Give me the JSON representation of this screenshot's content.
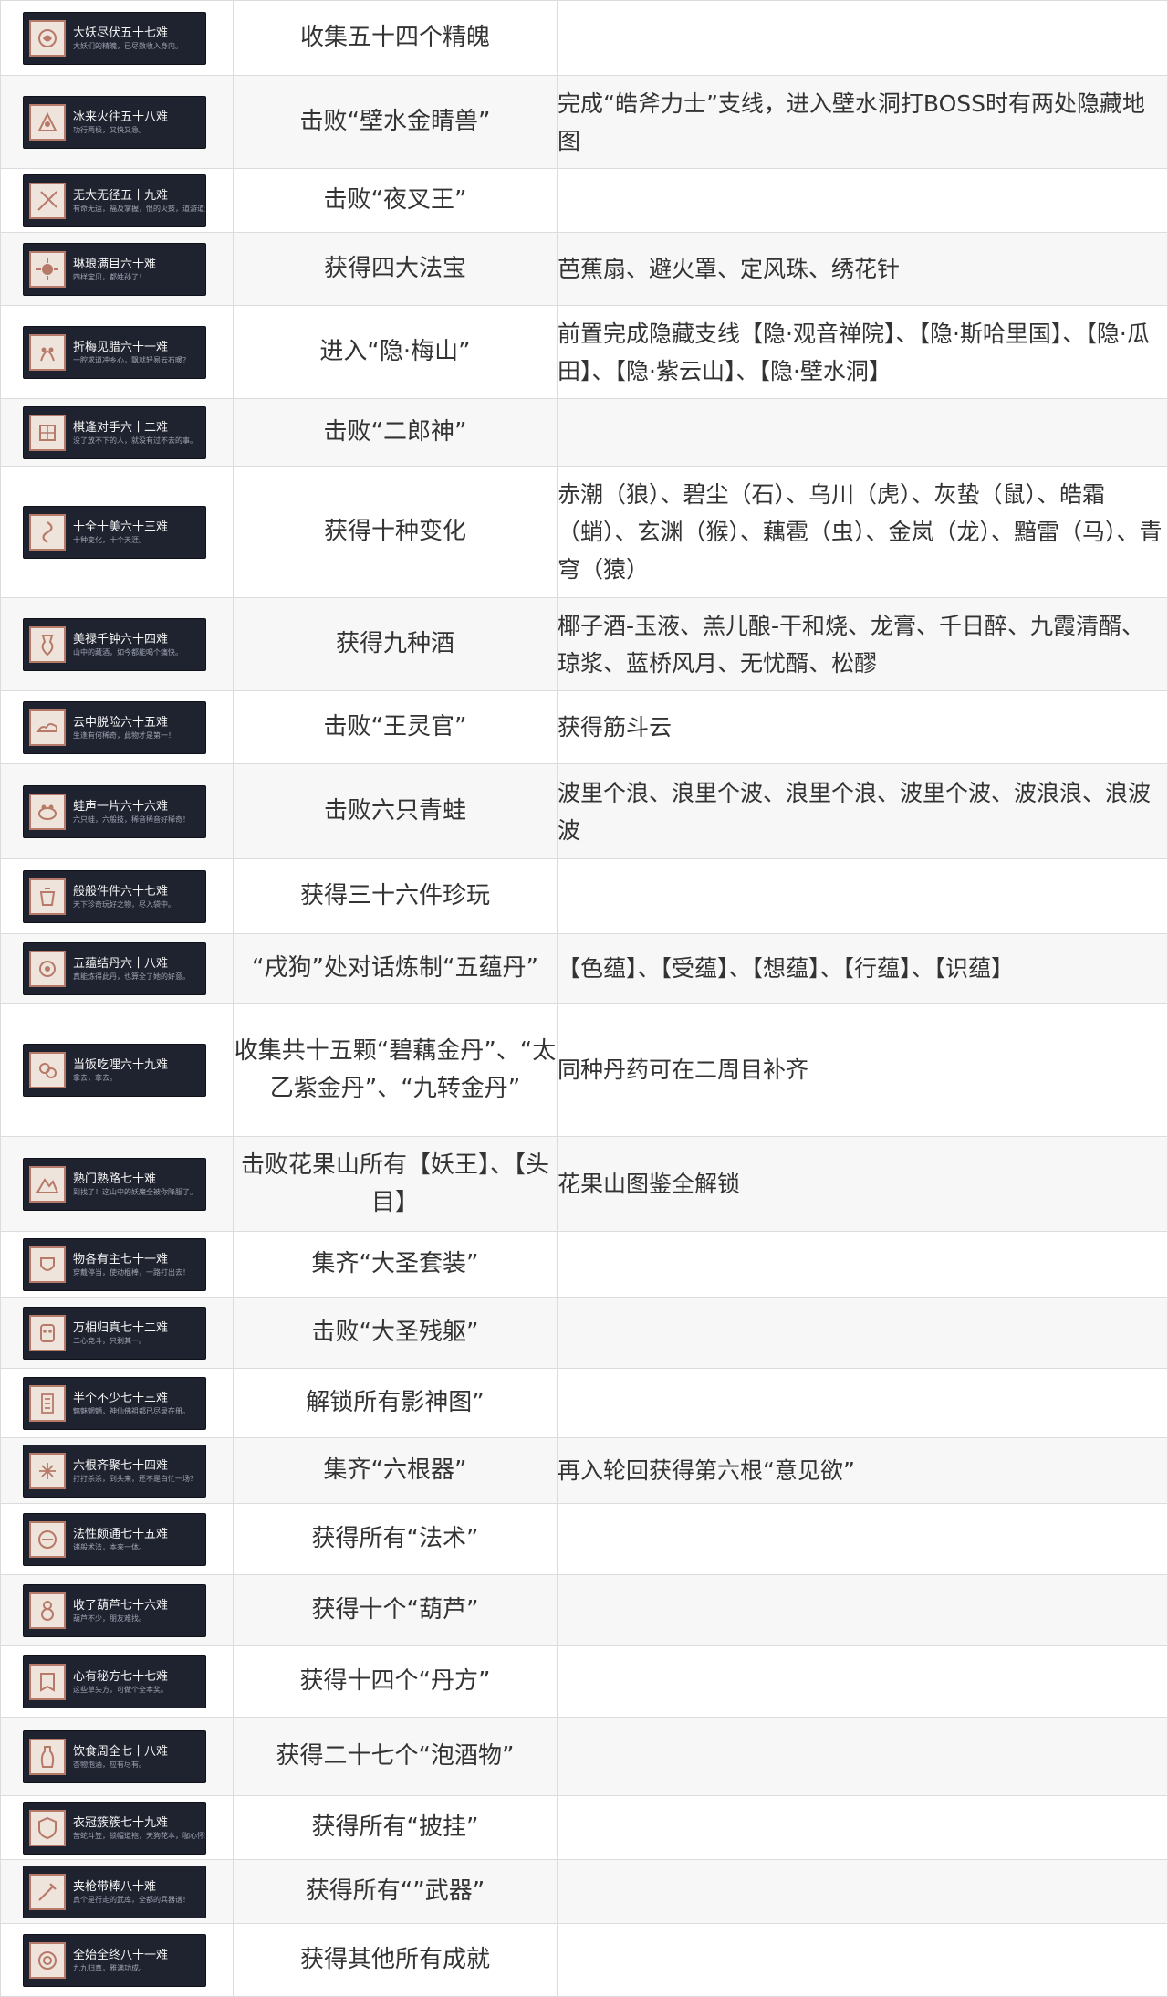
{
  "rows": [
    {
      "title": "大妖尽伏五十七难",
      "subtitle": "大妖们的精魄，已尽数收入身内。",
      "condition": "收集五十四个精魄",
      "note": "",
      "icon": "spirit-icon"
    },
    {
      "title": "冰来火往五十八难",
      "subtitle": "功行两极，又快又急。",
      "condition": "击败“壁水金睛兽”",
      "note": "完成“皓斧力士”支线，进入壁水洞打BOSS时有两处隐藏地图",
      "icon": "beast-icon"
    },
    {
      "title": "无大无径五十九难",
      "subtitle": "有命无运，福及掌握，恨的火鼓，道游道游。",
      "condition": "击败“夜叉王”",
      "note": "",
      "icon": "spear-icon"
    },
    {
      "title": "琳琅满目六十难",
      "subtitle": "四样宝贝，都姓孙了！",
      "condition": "获得四大法宝",
      "note": "芭蕉扇、避火罩、定风珠、绣花针",
      "icon": "treasure-icon"
    },
    {
      "title": "折梅见腊六十一难",
      "subtitle": "一腔求道冲乡心，飘就轻易云石暖？",
      "condition": "进入“隐·梅山”",
      "note": "前置完成隐藏支线【隐·观音禅院】、【隐·斯哈里国】、【隐·瓜田】、【隐·紫云山】、【隐·壁水洞】",
      "icon": "plum-icon"
    },
    {
      "title": "棋逢对手六十二难",
      "subtitle": "没了放不下的人，就没有过不去的事。",
      "condition": "击败“二郎神”",
      "note": "",
      "icon": "chess-icon"
    },
    {
      "title": "十全十美六十三难",
      "subtitle": "十种变化，十个天涯。",
      "condition": "获得十种变化",
      "note": "赤潮（狼）、碧尘（石）、乌川（虎）、灰蛰（鼠）、皓霜（蛸）、玄渊（猴）、藕雹（虫）、金岚（龙）、黯雷（马）、青穹（猿）",
      "icon": "transform-icon"
    },
    {
      "title": "美禄千钟六十四难",
      "subtitle": "山中的藏酒，如今都能喝个痛快。",
      "condition": "获得九种酒",
      "note": "椰子酒-玉液、羔儿酿-干和烧、龙膏、千日醉、九霞清醑、琼浆、蓝桥风月、无忧醑、松醪",
      "icon": "wine-icon"
    },
    {
      "title": "云中脱险六十五难",
      "subtitle": "生逢有何稀奇，此物才是第一！",
      "condition": "击败“王灵官”",
      "note": "获得筋斗云",
      "icon": "cloud-icon"
    },
    {
      "title": "蛙声一片六十六难",
      "subtitle": "六只蛙，六般技，稀音稀音好稀奇！",
      "condition": "击败六只青蛙",
      "note": "波里个浪、浪里个波、浪里个浪、波里个波、波浪浪、浪波波",
      "icon": "frog-icon"
    },
    {
      "title": "般般件件六十七难",
      "subtitle": "天下珍奇玩好之物，尽入袋中。",
      "condition": "获得三十六件珍玩",
      "note": "",
      "icon": "curio-icon"
    },
    {
      "title": "五蕴结丹六十八难",
      "subtitle": "真能炼得此丹，也算全了她的好意。",
      "condition": "“戌狗”处对话炼制“五蕴丹”",
      "note": "【色蕴】、【受蕴】、【想蕴】、【行蕴】、【识蕴】",
      "icon": "pill-icon"
    },
    {
      "title": "当饭吃哩六十九难",
      "subtitle": "拿去，拿去。",
      "condition": "收集共十五颗“碧藕金丹”、“太乙紫金丹”、“九转金丹”",
      "note": "同种丹药可在二周目补齐",
      "icon": "elixir-icon"
    },
    {
      "title": "熟门熟路七十难",
      "subtitle": "到找了！这山中的妖魔全被你降服了。",
      "condition": "击败花果山所有【妖王】、【头目】",
      "note": "花果山图鉴全解锁",
      "icon": "mountain-icon"
    },
    {
      "title": "物各有主七十一难",
      "subtitle": "穿戴停当，使动棍棒，一路打出去！",
      "condition": "集齐“大圣套装”",
      "note": "",
      "icon": "armor-icon"
    },
    {
      "title": "万相归真七十二难",
      "subtitle": "二心竞斗，只剩其一。",
      "condition": "击败“大圣残躯”",
      "note": "",
      "icon": "mask-icon"
    },
    {
      "title": "半个不少七十三难",
      "subtitle": "魑魅魍魉，神仙佛祖都已尽录在册。",
      "condition": "解锁所有影神图”",
      "note": "",
      "icon": "scroll-icon"
    },
    {
      "title": "六根齐聚七十四难",
      "subtitle": "打打杀杀，到头来，还不是白忙一场？",
      "condition": "集齐“六根器”",
      "note": "再入轮回获得第六根“意见欲”",
      "icon": "relic-icon"
    },
    {
      "title": "法性颇通七十五难",
      "subtitle": "诸般术法，本来一体。",
      "condition": "获得所有“法术”",
      "note": "",
      "icon": "spell-icon"
    },
    {
      "title": "收了葫芦七十六难",
      "subtitle": "葫芦不少，朋友难找。",
      "condition": "获得十个“葫芦”",
      "note": "",
      "icon": "gourd-icon"
    },
    {
      "title": "心有秘方七十七难",
      "subtitle": "这些草头方，可做个全本奖。",
      "condition": "获得十四个“丹方”",
      "note": "",
      "icon": "recipe-icon"
    },
    {
      "title": "饮食周全七十八难",
      "subtitle": "杏物泡酒，应有尽有。",
      "condition": "获得二十七个“泡酒物”",
      "note": "",
      "icon": "vase-icon"
    },
    {
      "title": "衣冠簇簇七十九难",
      "subtitle": "苦蛇斗笠，锁帽道袍，天狗花本，咖心怀就。",
      "condition": "获得所有“披挂”",
      "note": "",
      "icon": "shield-icon"
    },
    {
      "title": "夹枪带棒八十难",
      "subtitle": "真个是行走的武库，全都的兵器谱！",
      "condition": "获得所有“”武器”",
      "note": "",
      "icon": "weapon-icon"
    },
    {
      "title": "全始全终八十一难",
      "subtitle": "九九归真，雅满功成。",
      "condition": "获得其他所有成就",
      "note": "",
      "icon": "circle-icon"
    }
  ],
  "colors": {
    "badge_bg": "#1f2330",
    "emblem_border": "#b77a68",
    "emblem_bg": "#efe4dc"
  }
}
